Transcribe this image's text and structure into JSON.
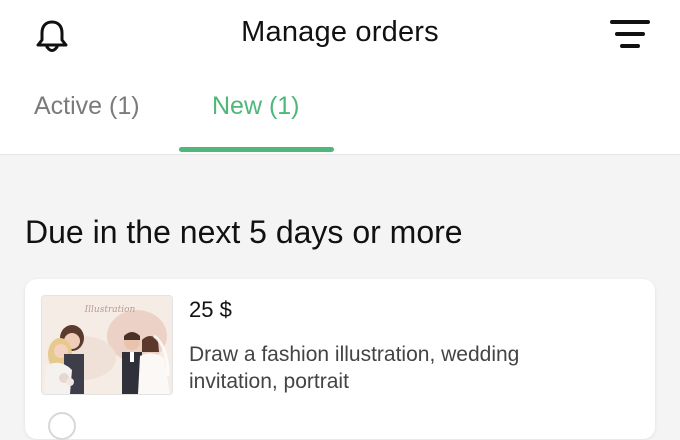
{
  "header": {
    "title": "Manage orders",
    "bell_icon": "bell-icon",
    "menu_icon": "filter-menu-icon"
  },
  "tabs": [
    {
      "label": "Active (1)",
      "selected": false
    },
    {
      "label": "New (1)",
      "selected": true
    }
  ],
  "section": {
    "title": "Due in the next 5 days or more"
  },
  "orders": [
    {
      "price": "25 $",
      "description": "Draw a fashion illustration, wedding invitation, portrait",
      "thumbnail_text": "Illustration"
    }
  ],
  "colors": {
    "accent": "#4fb77a",
    "muted_tab": "#7b7b7b",
    "background": "#f4f4f4"
  }
}
